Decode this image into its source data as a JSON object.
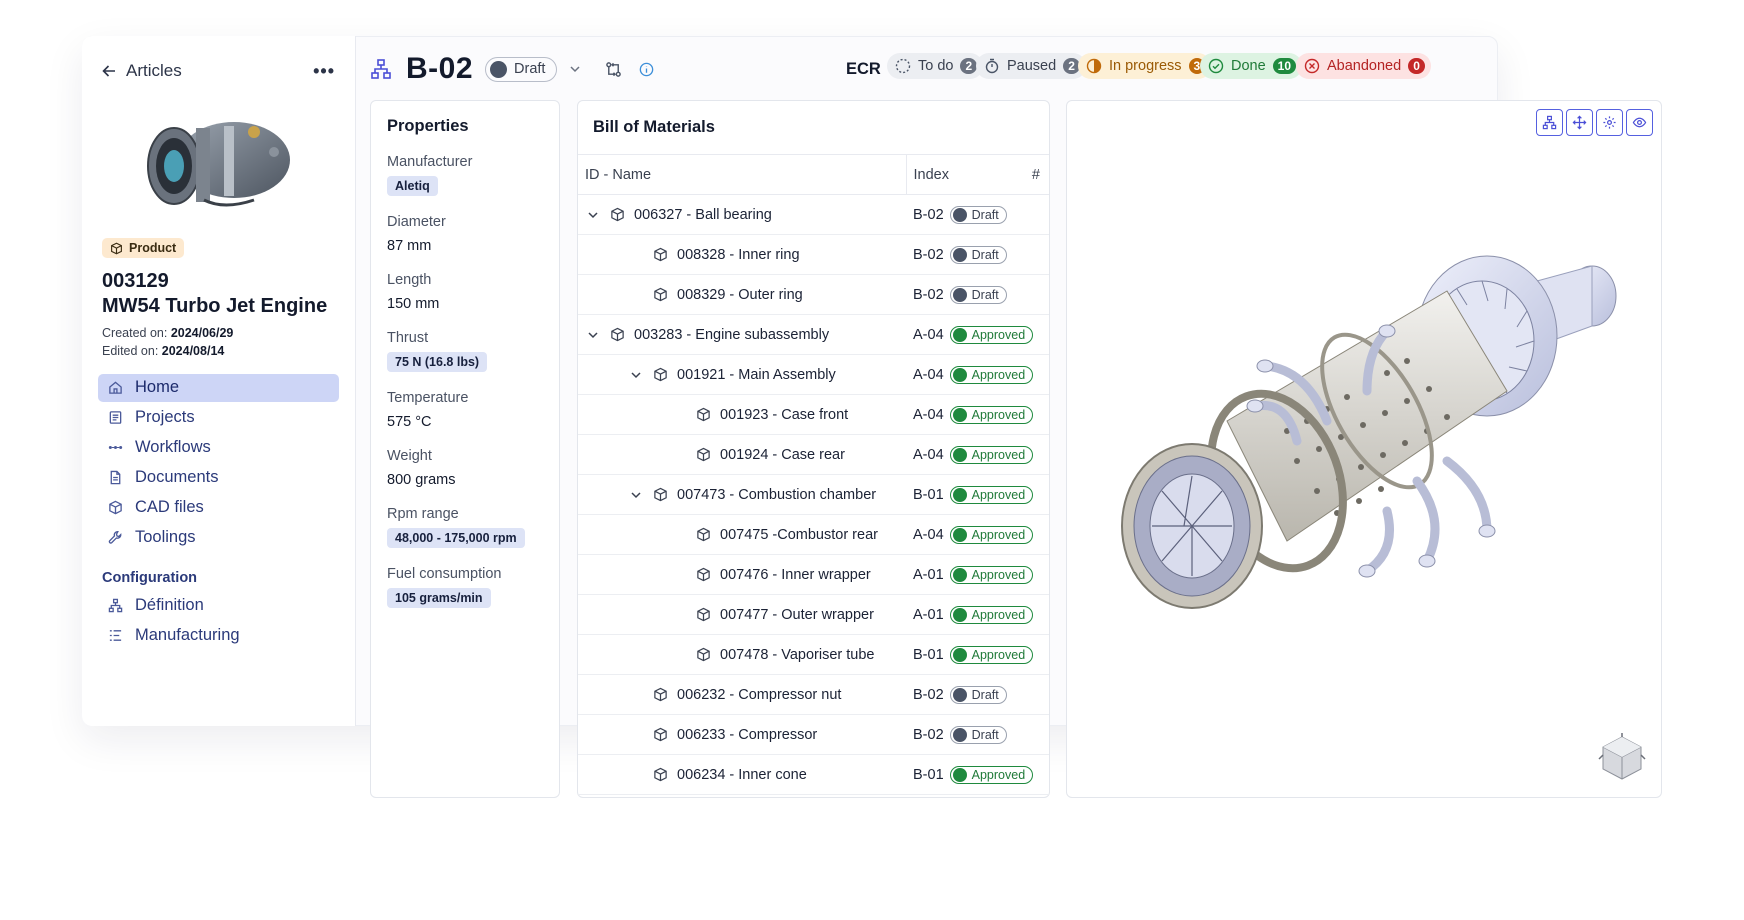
{
  "sidebar": {
    "back_label": "Articles",
    "more_label": "•••",
    "product_badge": "Product",
    "article_id": "003129",
    "article_name": "MW54 Turbo Jet Engine",
    "created_label": "Created on:",
    "created_value": "2024/06/29",
    "edited_label": "Edited on:",
    "edited_value": "2024/08/14",
    "nav": [
      {
        "label": "Home",
        "icon": "home-icon",
        "active": true
      },
      {
        "label": "Projects",
        "icon": "projects-icon",
        "active": false
      },
      {
        "label": "Workflows",
        "icon": "workflows-icon",
        "active": false
      },
      {
        "label": "Documents",
        "icon": "documents-icon",
        "active": false
      },
      {
        "label": "CAD files",
        "icon": "cube-icon",
        "active": false
      },
      {
        "label": "Toolings",
        "icon": "wrench-icon",
        "active": false
      }
    ],
    "config_label": "Configuration",
    "config_nav": [
      {
        "label": "Définition",
        "icon": "tree-icon"
      },
      {
        "label": "Manufacturing",
        "icon": "list-icon"
      }
    ]
  },
  "header": {
    "revision": "B-02",
    "state": "Draft",
    "ecr_label": "ECR",
    "statuses": [
      {
        "label": "To do",
        "count": "2",
        "bg": "#eceef2",
        "fg": "#3a4150",
        "count_bg": "#6b7280"
      },
      {
        "label": "Paused",
        "count": "2",
        "bg": "#eceef2",
        "fg": "#3a4150",
        "count_bg": "#6b7280"
      },
      {
        "label": "In progress",
        "count": "3",
        "bg": "#fdf0d6",
        "fg": "#9a5a05",
        "count_bg": "#c06a0a"
      },
      {
        "label": "Done",
        "count": "10",
        "bg": "#ddf3e2",
        "fg": "#1f7a38",
        "count_bg": "#1f8a3e"
      },
      {
        "label": "Abandoned",
        "count": "0",
        "bg": "#fde2e2",
        "fg": "#b42323",
        "count_bg": "#c42828"
      }
    ]
  },
  "properties": {
    "title": "Properties",
    "items": [
      {
        "label": "Manufacturer",
        "value": "Aletiq",
        "tag": true
      },
      {
        "label": "Diameter",
        "value": "87 mm",
        "tag": false
      },
      {
        "label": "Length",
        "value": "150 mm",
        "tag": false
      },
      {
        "label": "Thrust",
        "value": "75 N (16.8 lbs)",
        "tag": true
      },
      {
        "label": "Temperature",
        "value": "575 °C",
        "tag": false
      },
      {
        "label": "Weight",
        "value": "800 grams",
        "tag": false
      },
      {
        "label": "Rpm range",
        "value": "48,000 - 175,000 rpm",
        "tag": true
      },
      {
        "label": "Fuel consumption",
        "value": "105 grams/min",
        "tag": true
      }
    ]
  },
  "bom": {
    "title": "Bill of Materials",
    "col_name": "ID - Name",
    "col_index": "Index",
    "col_hash": "#",
    "rows": [
      {
        "depth": 0,
        "expand": true,
        "name": "006327 - Ball bearing",
        "index": "B-02",
        "state": "Draft"
      },
      {
        "depth": 1,
        "expand": false,
        "name": "008328 - Inner ring",
        "index": "B-02",
        "state": "Draft"
      },
      {
        "depth": 1,
        "expand": false,
        "name": "008329 - Outer ring",
        "index": "B-02",
        "state": "Draft"
      },
      {
        "depth": 0,
        "expand": true,
        "name": "003283 - Engine subassembly",
        "index": "A-04",
        "state": "Approved"
      },
      {
        "depth": 1,
        "expand": true,
        "name": "001921 - Main Assembly",
        "index": "A-04",
        "state": "Approved"
      },
      {
        "depth": 2,
        "expand": false,
        "name": "001923 - Case front",
        "index": "A-04",
        "state": "Approved"
      },
      {
        "depth": 2,
        "expand": false,
        "name": "001924 - Case rear",
        "index": "A-04",
        "state": "Approved"
      },
      {
        "depth": 1,
        "expand": true,
        "name": "007473 - Combustion chamber",
        "index": "B-01",
        "state": "Approved"
      },
      {
        "depth": 2,
        "expand": false,
        "name": "007475 -Combustor rear",
        "index": "A-04",
        "state": "Approved"
      },
      {
        "depth": 2,
        "expand": false,
        "name": "007476 - Inner wrapper",
        "index": "A-01",
        "state": "Approved"
      },
      {
        "depth": 2,
        "expand": false,
        "name": "007477 - Outer wrapper",
        "index": "A-01",
        "state": "Approved"
      },
      {
        "depth": 2,
        "expand": false,
        "name": "007478 - Vaporiser tube",
        "index": "B-01",
        "state": "Approved"
      },
      {
        "depth": 1,
        "expand": false,
        "name": "006232 - Compressor nut",
        "index": "B-02",
        "state": "Draft"
      },
      {
        "depth": 1,
        "expand": false,
        "name": "006233 - Compressor",
        "index": "B-02",
        "state": "Draft"
      },
      {
        "depth": 1,
        "expand": false,
        "name": "006234 - Inner cone",
        "index": "B-01",
        "state": "Approved"
      }
    ]
  },
  "viewer": {
    "tools": [
      "tree-icon",
      "move-icon",
      "explode-icon",
      "eye-icon"
    ]
  }
}
